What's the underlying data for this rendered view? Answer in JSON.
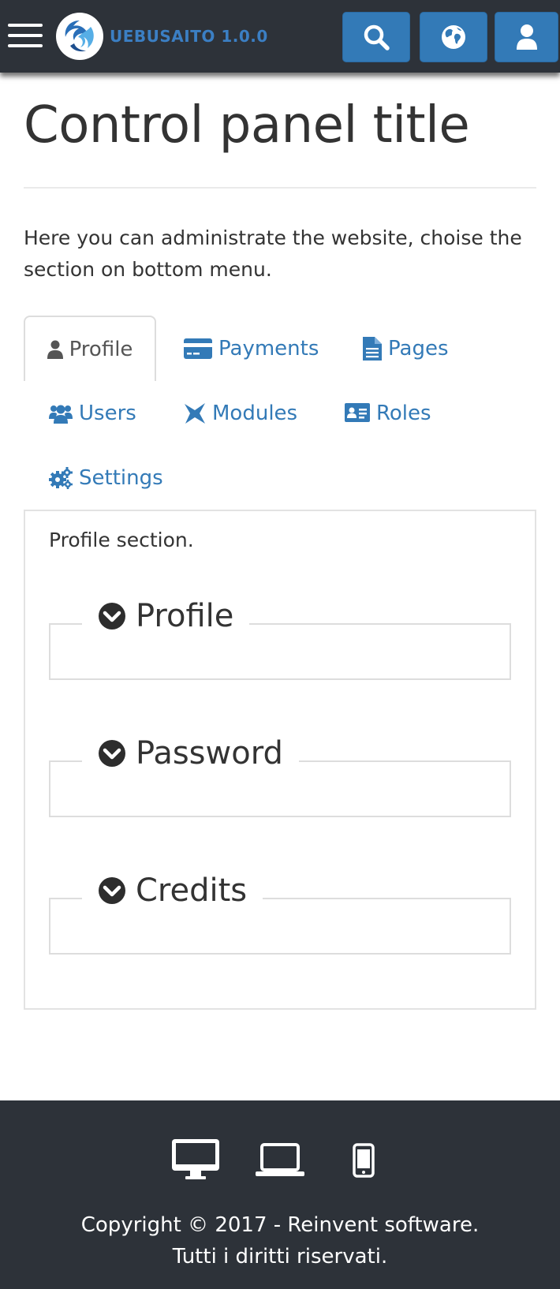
{
  "header": {
    "brand": "UEBUSAITO 1.0.0",
    "icons": [
      "menu-icon",
      "logo",
      "search-icon",
      "globe-icon",
      "user-icon"
    ]
  },
  "main": {
    "title": "Control panel title",
    "intro": "Here you can administrate the website, choise the section on bottom menu.",
    "tabs": [
      {
        "label": "Profile",
        "icon": "user-icon",
        "active": true
      },
      {
        "label": "Payments",
        "icon": "credit-card-icon",
        "active": false
      },
      {
        "label": "Pages",
        "icon": "file-icon",
        "active": false
      },
      {
        "label": "Users",
        "icon": "users-icon",
        "active": false
      },
      {
        "label": "Modules",
        "icon": "modules-icon",
        "active": false
      },
      {
        "label": "Roles",
        "icon": "id-card-icon",
        "active": false
      },
      {
        "label": "Settings",
        "icon": "cogs-icon",
        "active": false
      }
    ],
    "panel": {
      "text": "Profile section.",
      "sections": [
        {
          "label": "Profile",
          "icon": "chevron-down-circle-icon"
        },
        {
          "label": "Password",
          "icon": "chevron-down-circle-icon"
        },
        {
          "label": "Credits",
          "icon": "chevron-down-circle-icon"
        }
      ]
    }
  },
  "footer": {
    "devices": [
      "desktop-icon",
      "laptop-icon",
      "mobile-icon"
    ],
    "copyright_line1": "Copyright © 2017 - Reinvent software.",
    "copyright_line2": "Tutti i diritti riservati."
  },
  "colors": {
    "topbar_bg": "#2d3239",
    "accent": "#337ab7",
    "brand_text": "#3b7fc4",
    "footer_bg": "#2d3239"
  }
}
